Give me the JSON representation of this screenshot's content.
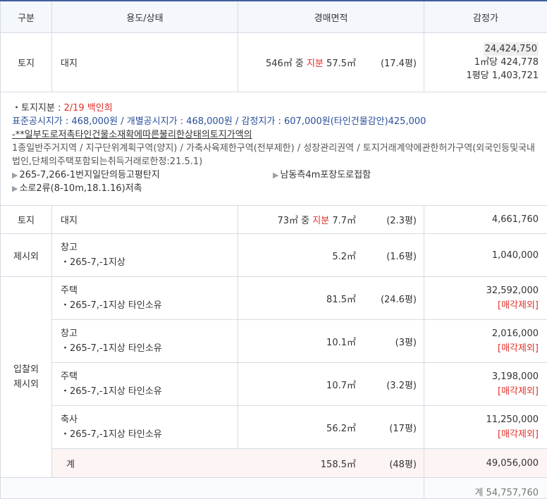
{
  "header": {
    "col1": "구분",
    "col2": "용도/상태",
    "col3": "경매면적",
    "col4": "감정가"
  },
  "row1": {
    "kind": "토지",
    "use": "대지",
    "area_total": "546㎡ 중 ",
    "area_share_label": "지분",
    "area_share": " 57.5㎡",
    "pyeong": "(17.4평)",
    "price": "24,424,750",
    "per_m2": "1㎡당 424,778",
    "per_pyeong": "1평당 1,403,721"
  },
  "info": {
    "share_label": "・토지지분 : ",
    "share_value": "2/19 백인희",
    "line2": "표준공시지가 : 468,000원 / 개별공시지가 : 468,000원 / 감정지가 : 607,000원(타인건물감안)425,000",
    "line3": "-**일부도로저촉타인건물소재확에따른불리한상태의토지가액의",
    "line4": "1종일반주거지역 / 지구단위계획구역(양지) / 가축사육제한구역(전부제한) / 성장관리권역 / 토지거래계약에관한허가구역(외국인등및국내법인,단체의주택포함되는취득거래로한정:21.5.1)",
    "b1": "265-7,266-1번지일단의등고평탄지",
    "b2": "남동측4m포장도로접함",
    "b3": "소로2류(8-10m,18.1.16)저촉"
  },
  "row2": {
    "kind": "토지",
    "use": "대지",
    "area_total": "73㎡ 중 ",
    "area_share_label": "지분",
    "area_share": " 7.7㎡",
    "pyeong": "(2.3평)",
    "price": "4,661,760"
  },
  "row3": {
    "kind": "제시외",
    "use": "창고",
    "sub": "・265-7,-1지상",
    "area": "5.2㎡",
    "pyeong": "(1.6평)",
    "price": "1,040,000"
  },
  "group_label1": "입찰외",
  "group_label2": "제시외",
  "exclude_label": "[매각제외]",
  "rows": [
    {
      "use": "주택",
      "sub": "・265-7,-1지상 타인소유",
      "area": "81.5㎡",
      "pyeong": "(24.6평)",
      "price": "32,592,000"
    },
    {
      "use": "창고",
      "sub": "・265-7,-1지상 타인소유",
      "area": "10.1㎡",
      "pyeong": "(3평)",
      "price": "2,016,000"
    },
    {
      "use": "주택",
      "sub": "・265-7,-1지상 타인소유",
      "area": "10.7㎡",
      "pyeong": "(3.2평)",
      "price": "3,198,000"
    },
    {
      "use": "축사",
      "sub": "・265-7,-1지상 타인소유",
      "area": "56.2㎡",
      "pyeong": "(17평)",
      "price": "11,250,000"
    }
  ],
  "sum": {
    "label": "계",
    "area": "158.5㎡",
    "pyeong": "(48평)",
    "price": "49,056,000"
  },
  "total": {
    "text": "계 54,757,760"
  }
}
